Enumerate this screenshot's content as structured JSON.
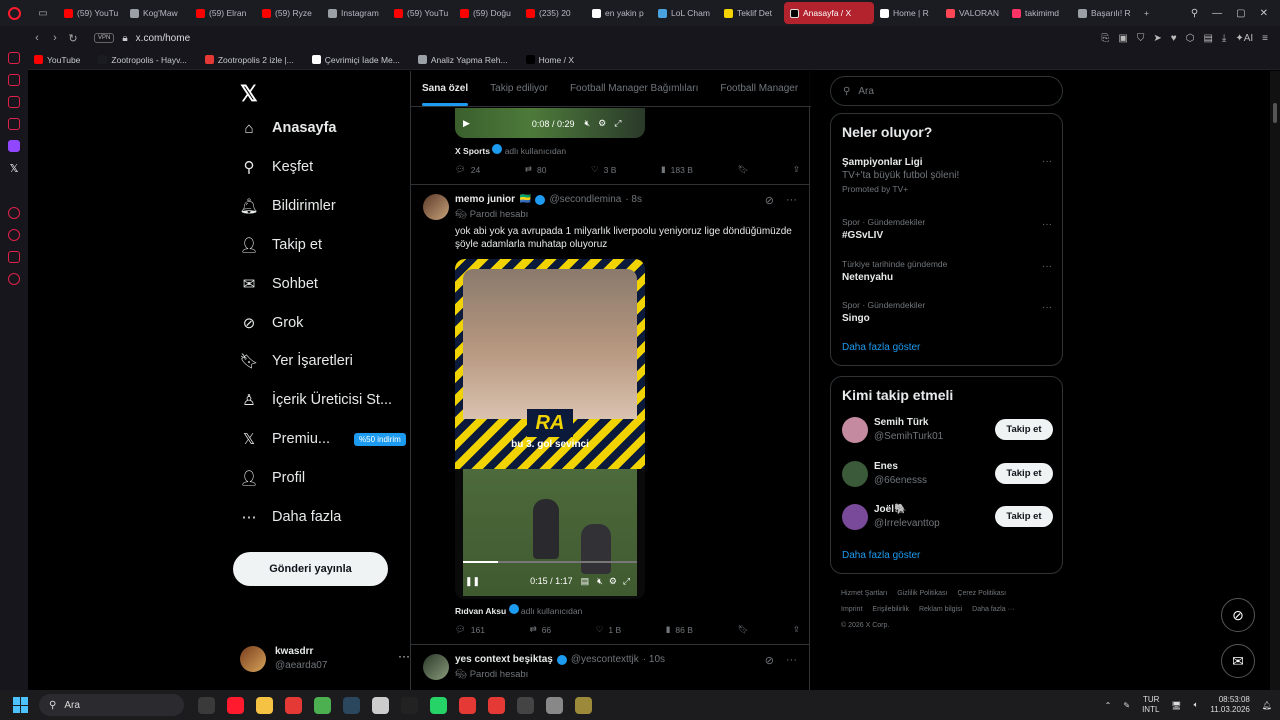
{
  "browser": {
    "tabs": [
      {
        "label": "(59) YouTu",
        "color": "#ff0000"
      },
      {
        "label": "Kog'Maw",
        "color": "#9aa0a6"
      },
      {
        "label": "(59) Elran",
        "color": "#ff0000"
      },
      {
        "label": "(59) Ryze",
        "color": "#ff0000"
      },
      {
        "label": "Instagram",
        "color": "#9aa0a6"
      },
      {
        "label": "(59) YouTu",
        "color": "#ff0000"
      },
      {
        "label": "(59) Doğu",
        "color": "#ff0000"
      },
      {
        "label": "(235) 20",
        "color": "#ff0000"
      },
      {
        "label": "en yakin p",
        "color": "#ffffff"
      },
      {
        "label": "LoL Cham",
        "color": "#4aa3df"
      },
      {
        "label": "Teklif Det",
        "color": "#f5d300"
      },
      {
        "label": "Anasayfa / X",
        "color": "#000000",
        "active": true
      },
      {
        "label": "Home | R",
        "color": "#ffffff"
      },
      {
        "label": "VALORAN",
        "color": "#ff4655"
      },
      {
        "label": "takimimd",
        "color": "#ff3366"
      },
      {
        "label": "Başarılı! R",
        "color": "#9aa0a6"
      }
    ],
    "vpn_label": "VPN",
    "url": "x.com/home",
    "ai_label": "AI",
    "bookmarks": [
      {
        "label": "YouTube",
        "color": "#ff0000"
      },
      {
        "label": "Zootropolis - Hayv...",
        "color": "#1b1b22"
      },
      {
        "label": "Zootropolis 2 izle |...",
        "color": "#e53935"
      },
      {
        "label": "Çevrimiçi İade Me...",
        "color": "#ffffff"
      },
      {
        "label": "Analiz Yapma Reh...",
        "color": "#9aa0a6"
      },
      {
        "label": "Home / X",
        "color": "#000000"
      }
    ]
  },
  "nav": {
    "items": [
      {
        "label": "Anasayfa",
        "icon": "home-icon",
        "glyph": "⌂",
        "active": true
      },
      {
        "label": "Keşfet",
        "icon": "search-icon",
        "glyph": "⚲"
      },
      {
        "label": "Bildirimler",
        "icon": "bell-icon",
        "glyph": "🔔︎"
      },
      {
        "label": "Takip et",
        "icon": "follow-icon",
        "glyph": "👤︎"
      },
      {
        "label": "Sohbet",
        "icon": "mail-icon",
        "glyph": "✉"
      },
      {
        "label": "Grok",
        "icon": "grok-icon",
        "glyph": "⊘"
      },
      {
        "label": "Yer İşaretleri",
        "icon": "bookmark-icon",
        "glyph": "🔖︎"
      },
      {
        "label": "İçerik Üreticisi St...",
        "icon": "creator-icon",
        "glyph": "♙"
      },
      {
        "label": "Premiu...",
        "icon": "premium-icon",
        "glyph": "𝕏"
      },
      {
        "label": "Profil",
        "icon": "profile-icon",
        "glyph": "👤︎"
      },
      {
        "label": "Daha fazla",
        "icon": "more-icon",
        "glyph": "⋯"
      }
    ],
    "premium_badge": "%50 indirim",
    "post_button": "Gönderi yayınla",
    "account": {
      "name": "kwasdrr",
      "handle": "@aearda07"
    }
  },
  "feed": {
    "tabs": [
      "Sana özel",
      "Takip ediliyor",
      "Football Manager Bağımlıları",
      "Football Manager"
    ],
    "prev_video_time": "0:08 / 0:29",
    "prev_source_name": "X Sports",
    "prev_source_suffix": "adlı kullanıcıdan",
    "prev_actions": {
      "replies": "24",
      "reposts": "80",
      "likes": "3 B",
      "views": "183 B"
    },
    "tweet": {
      "name": "memo junior",
      "flag": "🇬🇦",
      "handle": "@secondlemina",
      "time": "· 8s",
      "parody": "Parodi hesabı",
      "text": "yok abi yok ya avrupada 1 milyarlık liverpoolu yeniyoruz lige döndüğümüzde şöyle adamlarla muhatap oluyoruz",
      "video_caption": "bu 3. gol sevinci",
      "video_logo": "RA",
      "video_time": "0:15 / 1:17",
      "source_name": "Rıdvan Aksu",
      "source_suffix": "adlı kullanıcıdan",
      "actions": {
        "replies": "161",
        "reposts": "66",
        "likes": "1 B",
        "views": "86 B"
      }
    },
    "next_tweet": {
      "name": "yes context beşiktaş",
      "handle": "@yescontexttjk",
      "time": "· 10s",
      "parody": "Parodi hesabı"
    }
  },
  "right": {
    "search_placeholder": "Ara",
    "trends_title": "Neler oluyor?",
    "trends": [
      {
        "context": "",
        "title": "Şampiyonlar Ligi",
        "subtitle": "TV+'ta büyük futbol şöleni!",
        "promo": "Promoted by TV+"
      },
      {
        "context": "Spor · Gündemdekiler",
        "title": "#GSvLIV"
      },
      {
        "context": "Türkiye tarihinde gündemde",
        "title": "Netenyahu"
      },
      {
        "context": "Spor · Gündemdekiler",
        "title": "Singo"
      }
    ],
    "trends_more": "Daha fazla göster",
    "who_title": "Kimi takip etmeli",
    "who": [
      {
        "name": "Semih Türk",
        "handle": "@SemihTurk01",
        "color": "#c48aa0"
      },
      {
        "name": "Enes",
        "handle": "@66enesss",
        "color": "#3a5a3a"
      },
      {
        "name": "Joël🐘",
        "handle": "@Irrelevanttop",
        "color": "#7a4a9a"
      }
    ],
    "follow_label": "Takip et",
    "who_more": "Daha fazla göster",
    "footer": [
      "Hizmet Şartları",
      "Gizlilik Politikası",
      "Çerez Politikası",
      "Imprint",
      "Erişilebilirlik",
      "Reklam bilgisi",
      "Daha fazla ···",
      "© 2026 X Corp."
    ]
  },
  "taskbar": {
    "search": "Ara",
    "lang": "TUR",
    "layout": "INTL",
    "time": "08:53:08",
    "date": "11.03.2026",
    "apps": [
      "#3a3a3a",
      "#ff1b2d",
      "#f5c243",
      "#e53935",
      "#4caf50",
      "#2a475e",
      "#cccccc",
      "#222222",
      "#25d366",
      "#e53935",
      "#e53935",
      "#444444",
      "#888888",
      "#9c8a3a"
    ]
  }
}
